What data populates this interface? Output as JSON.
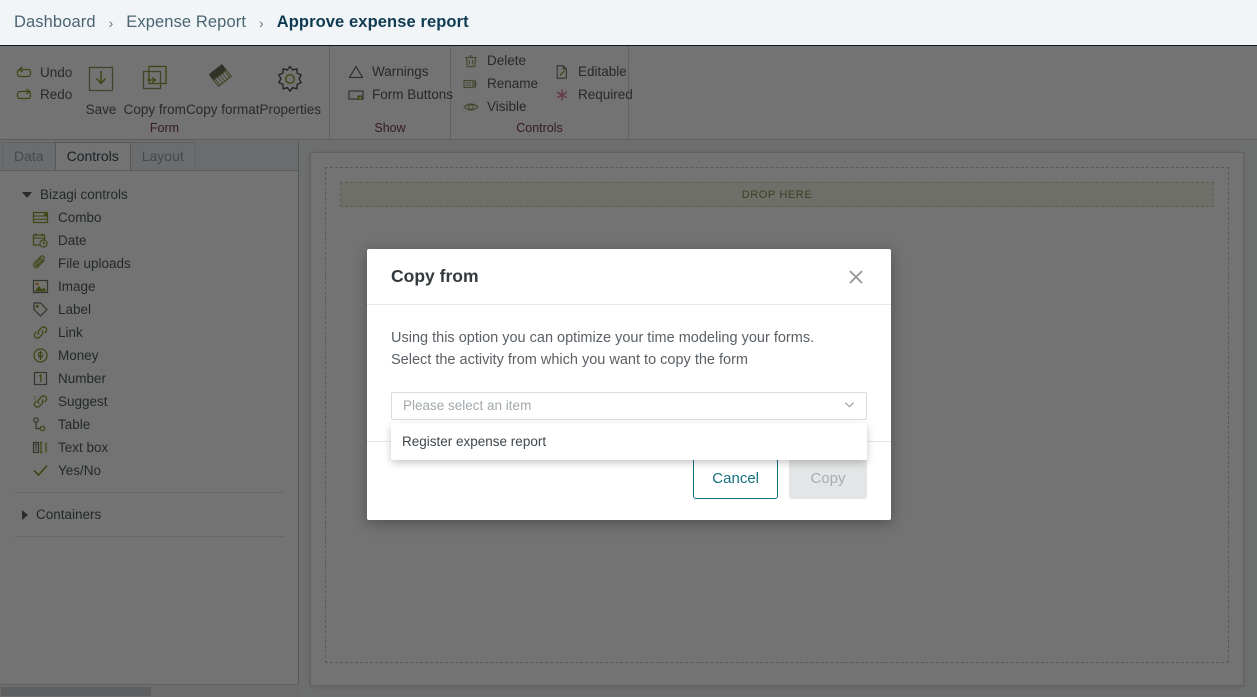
{
  "breadcrumb": {
    "items": [
      {
        "label": "Dashboard",
        "current": false
      },
      {
        "label": "Expense Report",
        "current": false
      },
      {
        "label": "Approve expense report",
        "current": true
      }
    ],
    "separator": "›"
  },
  "ribbon": {
    "groups": [
      {
        "name": "form",
        "label": "Form",
        "mini_commands": [
          {
            "label": "Undo",
            "icon": "undo-icon"
          },
          {
            "label": "Redo",
            "icon": "redo-icon"
          }
        ],
        "big_buttons": [
          {
            "label": "Save",
            "icon": "save-icon"
          },
          {
            "label": "Copy from",
            "icon": "copy-from-icon"
          },
          {
            "label": "Copy format",
            "icon": "copy-format-icon"
          },
          {
            "label": "Properties",
            "icon": "gear-icon"
          }
        ]
      },
      {
        "name": "show",
        "label": "Show",
        "commands": [
          {
            "label": "Warnings",
            "icon": "warning-triangle-icon"
          },
          {
            "label": "Form Buttons",
            "icon": "form-buttons-icon"
          }
        ]
      },
      {
        "name": "controls",
        "label": "Controls",
        "column_a": [
          {
            "label": "Delete",
            "icon": "trash-icon"
          },
          {
            "label": "Rename",
            "icon": "rename-icon"
          },
          {
            "label": "Visible",
            "icon": "eye-icon"
          }
        ],
        "column_b": [
          {
            "label": "Editable",
            "icon": "editable-page-icon"
          },
          {
            "label": "Required",
            "icon": "asterisk-icon"
          }
        ]
      }
    ]
  },
  "left_panel": {
    "tabs": [
      {
        "label": "Data",
        "active": false
      },
      {
        "label": "Controls",
        "active": true
      },
      {
        "label": "Layout",
        "active": false
      }
    ],
    "groups": [
      {
        "label": "Bizagi controls",
        "expanded": true,
        "items": [
          {
            "label": "Combo",
            "icon": "combo-icon"
          },
          {
            "label": "Date",
            "icon": "date-icon"
          },
          {
            "label": "File uploads",
            "icon": "paperclip-icon"
          },
          {
            "label": "Image",
            "icon": "image-icon"
          },
          {
            "label": "Label",
            "icon": "tag-icon"
          },
          {
            "label": "Link",
            "icon": "link-icon"
          },
          {
            "label": "Money",
            "icon": "money-icon"
          },
          {
            "label": "Number",
            "icon": "number-icon"
          },
          {
            "label": "Suggest",
            "icon": "suggest-icon"
          },
          {
            "label": "Table",
            "icon": "table-icon"
          },
          {
            "label": "Text box",
            "icon": "textbox-icon"
          },
          {
            "label": "Yes/No",
            "icon": "check-icon"
          }
        ]
      },
      {
        "label": "Containers",
        "expanded": false,
        "items": []
      }
    ]
  },
  "canvas": {
    "drop_zone_label": "DROP HERE"
  },
  "modal": {
    "title": "Copy from",
    "close_icon": "close-icon",
    "description": "Using this option you can optimize your time modeling your forms.\nSelect the activity from which you want to copy the form",
    "select": {
      "placeholder": "Please select an item",
      "value": "",
      "chevron_icon": "chevron-down-icon",
      "open": true,
      "options": [
        {
          "label": "Register expense report"
        }
      ]
    },
    "buttons": {
      "cancel_label": "Cancel",
      "copy_label": "Copy",
      "copy_disabled": true
    }
  },
  "colors": {
    "accent_teal": "#15707e",
    "breadcrumb_current": "#0f3b52",
    "ribbon_group_label": "#7a3b4c",
    "icon_olive": "#8a9a28",
    "drop_zone_bg": "#f4f6e8",
    "required_pink": "#e68aa0"
  }
}
